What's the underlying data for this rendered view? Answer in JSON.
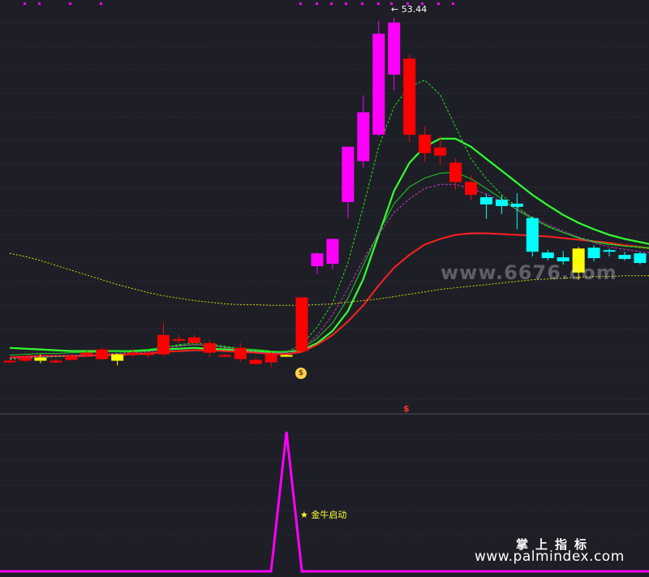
{
  "labels": {
    "max_price": "53.44",
    "signal": "金牛启动",
    "signal_star": "★",
    "money_icon": "$",
    "dollar_mark": "$",
    "watermark_top": "www.6676.com",
    "watermark_cn": "掌上指标",
    "watermark_url": "www.palmindex.com"
  },
  "colors": {
    "background": "#1e1f26",
    "grid": "#3a3c4a",
    "up_red": "#ff0000",
    "magenta": "#ff00ff",
    "down_red": "#ff0000",
    "cyan": "#00ffff",
    "yellow": "#ffff00",
    "ma_green": "#33ff33",
    "ma_red": "#ff2020",
    "ma_yellow_dotted": "#d6d600",
    "signal_line": "#ff00ff"
  },
  "chart_data": [
    {
      "type": "candlestick",
      "title": "",
      "ylim": [
        7,
        55
      ],
      "max_label_value": 53.44,
      "candles": [
        {
          "o": 10.7,
          "h": 11.0,
          "l": 10.5,
          "c": 10.8,
          "color": "red"
        },
        {
          "o": 10.8,
          "h": 11.4,
          "l": 10.6,
          "c": 11.2,
          "color": "red"
        },
        {
          "o": 11.2,
          "h": 11.6,
          "l": 10.5,
          "c": 10.8,
          "color": "yellow"
        },
        {
          "o": 10.8,
          "h": 11.0,
          "l": 10.5,
          "c": 10.6,
          "color": "red"
        },
        {
          "o": 10.9,
          "h": 11.5,
          "l": 10.8,
          "c": 11.4,
          "color": "red"
        },
        {
          "o": 11.5,
          "h": 12.1,
          "l": 11.3,
          "c": 11.8,
          "color": "red"
        },
        {
          "o": 12.2,
          "h": 12.4,
          "l": 10.8,
          "c": 11.0,
          "color": "red"
        },
        {
          "o": 11.6,
          "h": 11.7,
          "l": 10.2,
          "c": 10.8,
          "color": "yellow"
        },
        {
          "o": 11.5,
          "h": 12.2,
          "l": 11.3,
          "c": 11.8,
          "color": "red"
        },
        {
          "o": 11.5,
          "h": 11.9,
          "l": 11.2,
          "c": 11.7,
          "color": "red"
        },
        {
          "o": 11.6,
          "h": 15.5,
          "l": 11.4,
          "c": 14.0,
          "color": "red"
        },
        {
          "o": 13.5,
          "h": 14.0,
          "l": 13.0,
          "c": 13.5,
          "color": "red"
        },
        {
          "o": 13.7,
          "h": 14.0,
          "l": 13.0,
          "c": 13.0,
          "color": "red"
        },
        {
          "o": 13.0,
          "h": 13.4,
          "l": 11.3,
          "c": 11.8,
          "color": "red"
        },
        {
          "o": 11.5,
          "h": 11.7,
          "l": 11.3,
          "c": 11.5,
          "color": "red"
        },
        {
          "o": 12.4,
          "h": 13.0,
          "l": 10.6,
          "c": 11.0,
          "color": "red"
        },
        {
          "o": 10.9,
          "h": 11.1,
          "l": 10.3,
          "c": 10.4,
          "color": "red"
        },
        {
          "o": 10.6,
          "h": 11.9,
          "l": 10.0,
          "c": 11.7,
          "color": "red"
        },
        {
          "o": 11.5,
          "h": 11.6,
          "l": 11.4,
          "c": 11.5,
          "color": "yellow"
        },
        {
          "o": 12.0,
          "h": 18.7,
          "l": 11.8,
          "c": 18.7,
          "color": "red"
        },
        {
          "o": 22.6,
          "h": 24.3,
          "l": 21.6,
          "c": 24.2,
          "color": "magenta"
        },
        {
          "o": 22.9,
          "h": 26.0,
          "l": 22.2,
          "c": 26.0,
          "color": "magenta"
        },
        {
          "o": 30.6,
          "h": 32.9,
          "l": 28.6,
          "c": 37.5,
          "color": "magenta"
        },
        {
          "o": 35.7,
          "h": 43.9,
          "l": 34.9,
          "c": 41.8,
          "color": "magenta"
        },
        {
          "o": 39.0,
          "h": 53.2,
          "l": 38.8,
          "c": 51.6,
          "color": "magenta"
        },
        {
          "o": 46.5,
          "h": 53.6,
          "l": 44.5,
          "c": 53.0,
          "color": "magenta"
        },
        {
          "o": 48.5,
          "h": 49.0,
          "l": 38.1,
          "c": 39.0,
          "color": "red"
        },
        {
          "o": 39.0,
          "h": 40.0,
          "l": 35.6,
          "c": 36.7,
          "color": "red"
        },
        {
          "o": 37.4,
          "h": 38.8,
          "l": 35.2,
          "c": 36.4,
          "color": "red"
        },
        {
          "o": 35.5,
          "h": 36.0,
          "l": 32.1,
          "c": 33.1,
          "color": "red"
        },
        {
          "o": 33.1,
          "h": 33.9,
          "l": 30.8,
          "c": 31.5,
          "color": "red"
        },
        {
          "o": 31.2,
          "h": 31.6,
          "l": 28.5,
          "c": 30.3,
          "color": "cyan"
        },
        {
          "o": 30.9,
          "h": 31.4,
          "l": 29.1,
          "c": 30.1,
          "color": "cyan"
        },
        {
          "o": 30.4,
          "h": 31.7,
          "l": 27.2,
          "c": 30.0,
          "color": "cyan"
        },
        {
          "o": 28.6,
          "h": 28.8,
          "l": 23.8,
          "c": 24.4,
          "color": "cyan"
        },
        {
          "o": 24.3,
          "h": 24.6,
          "l": 23.3,
          "c": 23.6,
          "color": "cyan"
        },
        {
          "o": 23.7,
          "h": 24.5,
          "l": 22.8,
          "c": 23.2,
          "color": "cyan"
        },
        {
          "o": 24.8,
          "h": 25.0,
          "l": 20.9,
          "c": 21.8,
          "color": "yellow"
        },
        {
          "o": 24.9,
          "h": 25.2,
          "l": 23.2,
          "c": 23.6,
          "color": "cyan"
        },
        {
          "o": 24.6,
          "h": 24.8,
          "l": 23.8,
          "c": 24.4,
          "color": "cyan"
        },
        {
          "o": 24.0,
          "h": 24.4,
          "l": 23.3,
          "c": 23.5,
          "color": "cyan"
        },
        {
          "o": 24.2,
          "h": 24.4,
          "l": 22.8,
          "c": 23.0,
          "color": "cyan"
        },
        {
          "o": 23.7,
          "h": 23.9,
          "l": 22.3,
          "c": 22.5,
          "color": "cyan"
        }
      ],
      "series": [
        {
          "style": "solid-green",
          "values": [
            12.4,
            12.3,
            12.2,
            12.1,
            12.0,
            12.0,
            12.0,
            12.0,
            12.0,
            12.1,
            12.2,
            12.3,
            12.4,
            12.3,
            12.2,
            12.1,
            12.0,
            11.9,
            11.9,
            12.1,
            13.0,
            14.5,
            17.0,
            21.0,
            26.5,
            32.0,
            35.5,
            37.5,
            38.5,
            38.5,
            37.5,
            36.0,
            34.5,
            33.0,
            31.5,
            30.2,
            29.0,
            28.0,
            27.2,
            26.5,
            26.0,
            25.6,
            25.2
          ]
        },
        {
          "style": "solid-red",
          "values": [
            11.2,
            11.3,
            11.4,
            11.4,
            11.4,
            11.4,
            11.5,
            11.5,
            11.6,
            11.7,
            11.9,
            12.0,
            12.1,
            12.1,
            12.0,
            11.9,
            11.8,
            11.7,
            11.6,
            11.9,
            12.8,
            14.0,
            15.7,
            17.7,
            20.2,
            22.4,
            24.0,
            25.3,
            26.0,
            26.5,
            26.7,
            26.7,
            26.6,
            26.5,
            26.4,
            26.3,
            26.1,
            25.9,
            25.7,
            25.5,
            25.2,
            25.0,
            24.7
          ]
        },
        {
          "style": "solid-green-2",
          "values": [
            11.5,
            11.6,
            11.7,
            11.7,
            11.8,
            11.8,
            11.9,
            12.0,
            12.1,
            12.2,
            12.5,
            12.7,
            12.8,
            12.7,
            12.5,
            12.3,
            12.2,
            12.0,
            11.9,
            12.3,
            13.6,
            15.5,
            18.6,
            22.7,
            26.8,
            30.4,
            32.5,
            33.6,
            34.2,
            34.3,
            33.5,
            32.3,
            31.0,
            29.6,
            28.5,
            27.6,
            26.8,
            26.1,
            25.6,
            25.3,
            25.1,
            25.0,
            24.9
          ]
        },
        {
          "style": "dashed-green",
          "values": [
            11.0,
            11.1,
            11.2,
            11.3,
            11.4,
            11.5,
            11.6,
            11.7,
            11.9,
            12.0,
            12.4,
            12.8,
            13.0,
            12.9,
            12.6,
            12.3,
            12.0,
            11.8,
            11.9,
            12.8,
            15.0,
            18.0,
            23.0,
            30.0,
            37.5,
            42.5,
            45.0,
            45.8,
            44.0,
            40.0,
            36.0,
            33.5,
            31.5,
            30.0,
            28.6,
            27.5,
            26.8,
            26.2,
            25.7,
            25.4,
            25.1,
            24.9,
            24.7
          ]
        },
        {
          "style": "dashed-magenta",
          "values": [
            11.1,
            11.2,
            11.3,
            11.4,
            11.5,
            11.5,
            11.6,
            11.7,
            11.8,
            11.9,
            12.2,
            12.6,
            12.8,
            12.7,
            12.4,
            12.1,
            11.9,
            11.7,
            11.8,
            12.4,
            14.0,
            16.5,
            19.8,
            23.4,
            26.6,
            29.3,
            31.0,
            32.3,
            32.8,
            32.8,
            32.3,
            31.6,
            30.7,
            29.7,
            28.7,
            27.8,
            27.0,
            26.2,
            25.5,
            25.0,
            24.7,
            24.4,
            24.2
          ]
        },
        {
          "style": "dotted-yellow",
          "values": [
            24.2,
            23.8,
            23.3,
            22.7,
            22.1,
            21.5,
            20.9,
            20.3,
            19.8,
            19.3,
            18.9,
            18.6,
            18.3,
            18.1,
            17.9,
            17.8,
            17.8,
            17.7,
            17.7,
            17.7,
            17.8,
            17.9,
            18.1,
            18.3,
            18.5,
            18.8,
            19.1,
            19.4,
            19.7,
            19.9,
            20.1,
            20.3,
            20.5,
            20.7,
            20.9,
            21.0,
            21.1,
            21.2,
            21.3,
            21.3,
            21.4,
            21.4,
            21.4
          ]
        }
      ]
    },
    {
      "type": "line",
      "title": "",
      "ylim": [
        0,
        100
      ],
      "values": [
        0,
        0,
        0,
        0,
        0,
        0,
        0,
        0,
        0,
        0,
        0,
        0,
        0,
        0,
        0,
        0,
        0,
        0,
        100,
        0,
        0,
        0,
        0,
        0,
        0,
        0,
        0,
        0,
        0,
        0,
        0,
        0,
        0,
        0,
        0,
        0,
        0,
        0,
        0,
        0,
        0,
        0,
        0
      ]
    }
  ]
}
